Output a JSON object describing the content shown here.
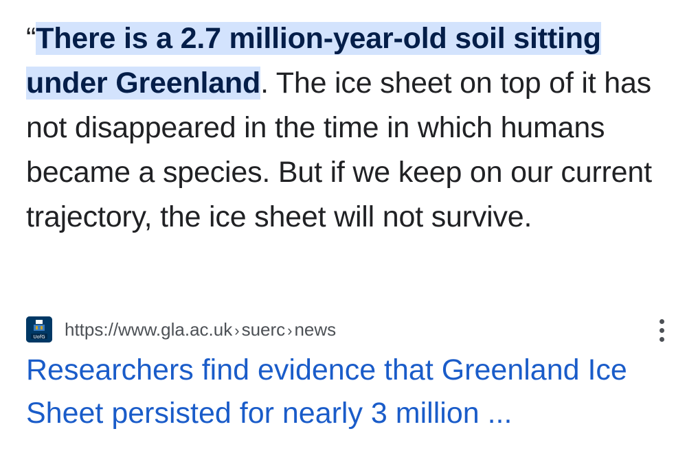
{
  "snippet": {
    "open_quote": "“",
    "highlighted": "There is a 2.7 million-year-old soil sitting under Greenland",
    "rest": ". The ice sheet on top of it has not disappeared in the time in which humans became a species. But if we keep on our current trajectory, the ice sheet will not survive."
  },
  "result": {
    "favicon_label": "UofG",
    "url_domain": "https://www.gla.ac.uk",
    "url_path_1": "suerc",
    "url_path_2": "news",
    "separator": "›",
    "more_icon": "more-vert-icon",
    "title": "Researchers find evidence that Greenland Ice Sheet persisted for nearly 3 million ..."
  },
  "colors": {
    "highlight_bg": "#d3e3fd",
    "link": "#1a5cc9",
    "text": "#202124",
    "url_text": "#4d5156",
    "favicon_bg": "#003865"
  }
}
